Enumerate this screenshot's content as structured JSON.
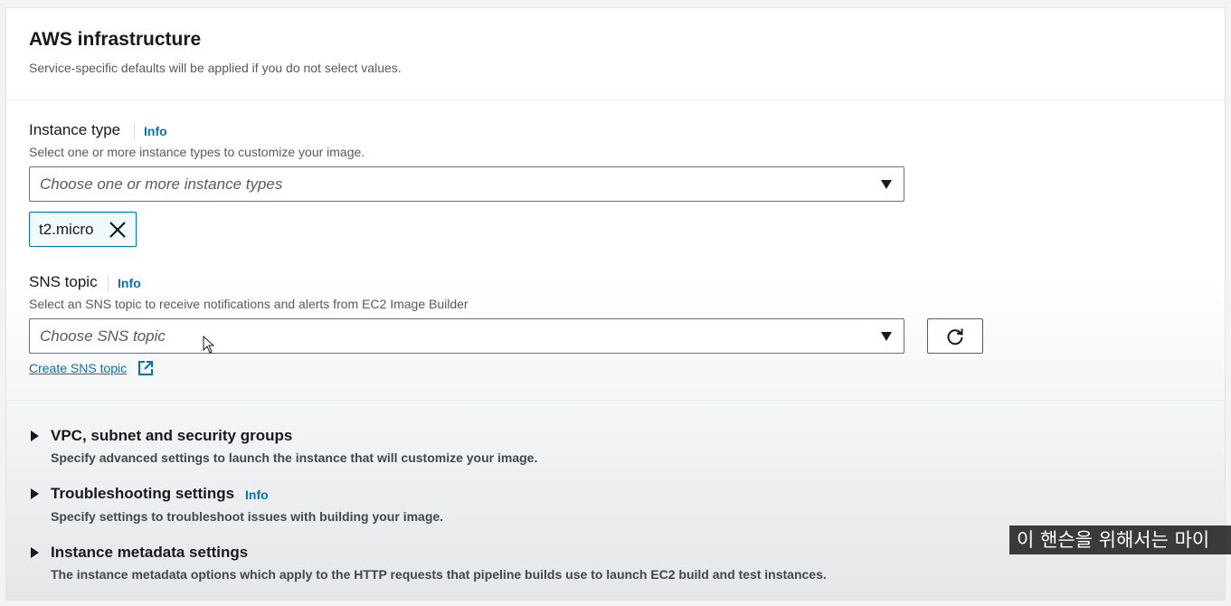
{
  "section": {
    "title": "AWS infrastructure",
    "subtitle": "Service-specific defaults will be applied if you do not select values."
  },
  "instance_type": {
    "label": "Instance type",
    "info": "Info",
    "description": "Select one or more instance types to customize your image.",
    "placeholder": "Choose one or more instance types",
    "selected_tokens": [
      "t2.micro"
    ]
  },
  "sns_topic": {
    "label": "SNS topic",
    "info": "Info",
    "description": "Select an SNS topic to receive notifications and alerts from EC2 Image Builder",
    "placeholder": "Choose SNS topic",
    "create_link": "Create SNS topic"
  },
  "expandables": [
    {
      "title": "VPC, subnet and security groups",
      "info": "",
      "description": "Specify advanced settings to launch the instance that will customize your image."
    },
    {
      "title": "Troubleshooting settings",
      "info": "Info",
      "description": "Specify settings to troubleshoot issues with building your image."
    },
    {
      "title": "Instance metadata settings",
      "info": "",
      "description": "The instance metadata options which apply to the HTTP requests that pipeline builds use to launch EC2 build and test instances."
    }
  ],
  "caption": {
    "text": "이 핸슨을 위해서는 마이"
  },
  "icons": {
    "remove": "close-icon",
    "refresh": "refresh-icon",
    "external": "external-link-icon",
    "dropdown": "caret-down-icon",
    "expand": "caret-right-icon"
  },
  "colors": {
    "link": "#0073bb",
    "token_border": "#0073bb",
    "token_bg": "#f1faff",
    "text": "#16191f"
  }
}
